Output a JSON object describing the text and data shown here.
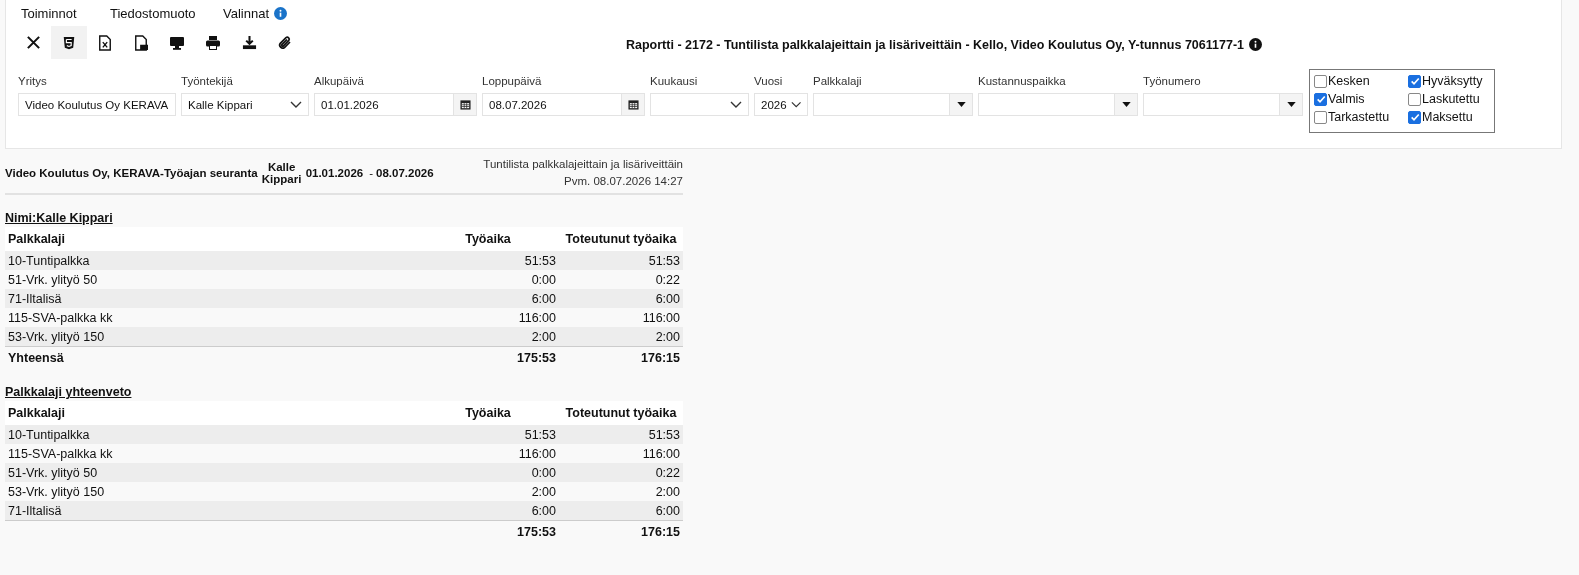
{
  "menu": [
    {
      "label": "Toiminnot",
      "info": false
    },
    {
      "label": "Tiedostomuoto",
      "info": false
    },
    {
      "label": "Valinnat",
      "info": true
    }
  ],
  "toolbar": [
    {
      "kind": "close",
      "selected": false
    },
    {
      "kind": "html",
      "selected": true
    },
    {
      "kind": "excel",
      "selected": false
    },
    {
      "kind": "pdf",
      "selected": false
    },
    {
      "kind": "screen",
      "selected": false
    },
    {
      "kind": "print",
      "selected": false
    },
    {
      "kind": "download",
      "selected": false
    },
    {
      "kind": "attach",
      "selected": false
    }
  ],
  "report_title": "Raportti - 2172 - Tuntilista palkkalajeittain ja lisäriveittäin - Kello, Video Koulutus Oy, Y-tunnus 7061177-1",
  "filters": [
    {
      "label": "Yritys",
      "kind": "select",
      "value": "Video Koulutus Oy KERAVA"
    },
    {
      "label": "Työntekijä",
      "kind": "select",
      "value": "Kalle Kippari"
    },
    {
      "label": "Alkupäivä",
      "kind": "date",
      "value": "01.01.2026"
    },
    {
      "label": "Loppupäivä",
      "kind": "date",
      "value": "08.07.2026"
    },
    {
      "label": "Kuukausi",
      "kind": "select"
    },
    {
      "label": "Vuosi",
      "kind": "select",
      "value": "2026"
    },
    {
      "label": "Palkkalaji",
      "kind": "combo"
    },
    {
      "label": "Kustannuspaikka",
      "kind": "combo"
    },
    {
      "label": "Työnumero",
      "kind": "combo"
    }
  ],
  "statuses": [
    {
      "label": "Kesken",
      "checked": false
    },
    {
      "label": "Hyväksytty",
      "checked": true
    },
    {
      "label": "Valmis",
      "checked": true
    },
    {
      "label": "Laskutettu",
      "checked": false
    },
    {
      "label": "Tarkastettu",
      "checked": false
    },
    {
      "label": "Maksettu",
      "checked": true
    }
  ],
  "report_header": {
    "company": "Video Koulutus Oy, KERAVA-Työajan seuranta",
    "employee": "Kalle Kippari",
    "start": "01.01.2026",
    "separator": "-",
    "end": "08.07.2026",
    "report_name": "Tuntilista palkkalajeittain ja lisäriveittäin",
    "printed": "Pvm. 08.07.2026 14:27"
  },
  "sections": [
    {
      "heading": "Nimi:Kalle Kippari",
      "columns": [
        "Palkkalaji",
        "Työaika",
        "Toteutunut työaika"
      ],
      "rows": [
        [
          "10-Tuntipalkka",
          "51:53",
          "51:53"
        ],
        [
          "51-Vrk. ylityö 50",
          "0:00",
          "0:22"
        ],
        [
          "71-Iltalisä",
          "6:00",
          "6:00"
        ],
        [
          "115-SVA-palkka kk",
          "116:00",
          "116:00"
        ],
        [
          "53-Vrk. ylityö 150",
          "2:00",
          "2:00"
        ]
      ],
      "total": {
        "label": "Yhteensä",
        "values": [
          "175:53",
          "176:15"
        ]
      }
    },
    {
      "heading": "Palkkalaji yhteenveto",
      "columns": [
        "Palkkalaji",
        "Työaika",
        "Toteutunut työaika"
      ],
      "rows": [
        [
          "10-Tuntipalkka",
          "51:53",
          "51:53"
        ],
        [
          "115-SVA-palkka kk",
          "116:00",
          "116:00"
        ],
        [
          "51-Vrk. ylityö 50",
          "0:00",
          "0:22"
        ],
        [
          "53-Vrk. ylityö 150",
          "2:00",
          "2:00"
        ],
        [
          "71-Iltalisä",
          "6:00",
          "6:00"
        ]
      ],
      "total": {
        "values": [
          "175:53",
          "176:15"
        ]
      }
    }
  ]
}
